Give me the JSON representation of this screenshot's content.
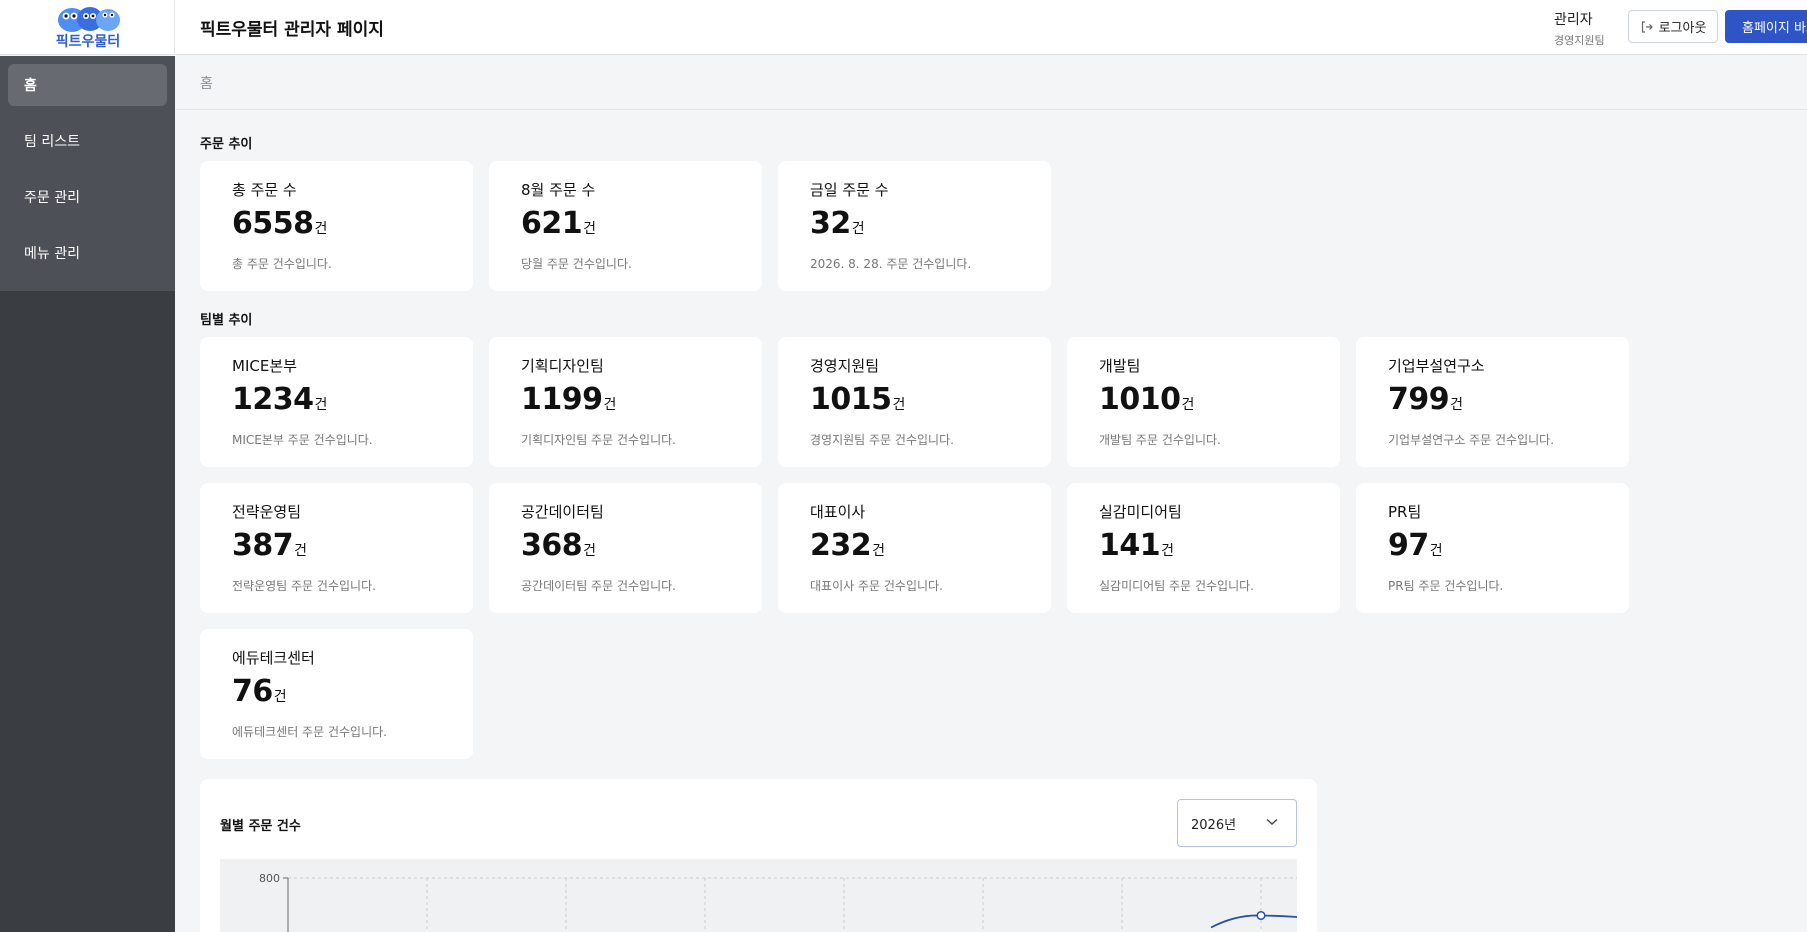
{
  "app": {
    "logo_text": "픽트우물터",
    "page_title": "픽트우물터 관리자 페이지",
    "user_role": "관리자",
    "user_team": "경영지원팀",
    "logout_label": "로그아웃",
    "home_label": "홈페이지 바로가기"
  },
  "sidebar": {
    "items": [
      {
        "label": "홈"
      },
      {
        "label": "팀 리스트"
      },
      {
        "label": "주문 관리"
      },
      {
        "label": "메뉴 관리"
      }
    ]
  },
  "breadcrumb": "홈",
  "order_trend": {
    "title": "주문 추이",
    "cards": [
      {
        "title": "총 주문 수",
        "value": "6558",
        "unit": "건",
        "desc": "총 주문 건수입니다."
      },
      {
        "title": "8월 주문 수",
        "value": "621",
        "unit": "건",
        "desc": "당월 주문 건수입니다."
      },
      {
        "title": "금일 주문 수",
        "value": "32",
        "unit": "건",
        "desc": "2026. 8. 28. 주문 건수입니다."
      }
    ]
  },
  "team_trend": {
    "title": "팀별 추이",
    "cards": [
      {
        "title": "MICE본부",
        "value": "1234",
        "unit": "건",
        "desc": "MICE본부 주문 건수입니다."
      },
      {
        "title": "기획디자인팀",
        "value": "1199",
        "unit": "건",
        "desc": "기획디자인팀 주문 건수입니다."
      },
      {
        "title": "경영지원팀",
        "value": "1015",
        "unit": "건",
        "desc": "경영지원팀 주문 건수입니다."
      },
      {
        "title": "개발팀",
        "value": "1010",
        "unit": "건",
        "desc": "개발팀 주문 건수입니다."
      },
      {
        "title": "기업부설연구소",
        "value": "799",
        "unit": "건",
        "desc": "기업부설연구소 주문 건수입니다."
      },
      {
        "title": "전략운영팀",
        "value": "387",
        "unit": "건",
        "desc": "전략운영팀 주문 건수입니다."
      },
      {
        "title": "공간데이터팀",
        "value": "368",
        "unit": "건",
        "desc": "공간데이터팀 주문 건수입니다."
      },
      {
        "title": "대표이사",
        "value": "232",
        "unit": "건",
        "desc": "대표이사 주문 건수입니다."
      },
      {
        "title": "실감미디어팀",
        "value": "141",
        "unit": "건",
        "desc": "실감미디어팀 주문 건수입니다."
      },
      {
        "title": "PR팀",
        "value": "97",
        "unit": "건",
        "desc": "PR팀 주문 건수입니다."
      },
      {
        "title": "에듀테크센터",
        "value": "76",
        "unit": "건",
        "desc": "에듀테크센터 주문 건수입니다."
      }
    ]
  },
  "monthly_chart": {
    "title": "월별 주문 건수",
    "year_selected": "2026년"
  },
  "chart_data": {
    "type": "line",
    "title": "월별 주문 건수",
    "y_tick_labels": [
      "800"
    ],
    "ylim": [
      0,
      800
    ],
    "grid": true,
    "colors": {
      "line": "#2e4fa8",
      "grid": "#c8cbd1"
    },
    "visible_points": [
      {
        "x_index": 7,
        "y": 700
      },
      {
        "x_index": 8,
        "y": 655
      }
    ]
  }
}
